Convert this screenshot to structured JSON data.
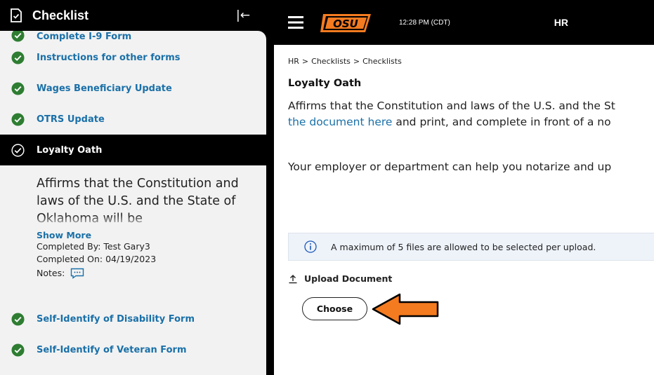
{
  "sidebar": {
    "title": "Checklist",
    "collapse_glyph": "|←",
    "partial_item_label": "Complete I-9 Form",
    "items_before": [
      {
        "label": "Instructions for other forms"
      },
      {
        "label": "Wages Beneficiary Update"
      },
      {
        "label": "OTRS Update"
      }
    ],
    "active_item": {
      "label": "Loyalty Oath",
      "description": "Affirms that the Constitution and laws of the U.S. and the State of Oklahoma will be",
      "show_more": "Show More",
      "completed_by": "Completed By: Test Gary3",
      "completed_on": "Completed On: 04/19/2023",
      "notes_label": "Notes:"
    },
    "items_after": [
      {
        "label": "Self-Identify of Disability Form"
      },
      {
        "label": "Self-Identify of Veteran Form"
      }
    ]
  },
  "topbar": {
    "time": "12:28 PM (CDT)",
    "app_title": "HR",
    "logo": "OSU"
  },
  "breadcrumb": [
    "HR",
    "Checklists",
    "Checklists"
  ],
  "breadcrumb_sep": ">",
  "main": {
    "title": "Loyalty Oath",
    "para_line1": "Affirms that the Constitution and laws of the U.S. and the St",
    "para_link": "the document here",
    "para_line2_rest": " and print, and complete in front of a no",
    "para2": "Your employer or department can help you notarize and up",
    "info_message": "A maximum of 5 files are allowed to be selected per upload.",
    "upload_label": "Upload Document",
    "choose_label": "Choose"
  },
  "icons": {
    "check": "check-circle-icon",
    "hamburger": "hamburger-menu-icon",
    "info": "info-icon",
    "upload": "upload-icon",
    "note": "comment-icon",
    "arrow": "orange-arrow-annotation"
  },
  "colors": {
    "check_green": "#2e7d32",
    "link_blue": "#1a70a8",
    "osu_orange": "#f47b20",
    "info_bg": "#eef3fa"
  }
}
